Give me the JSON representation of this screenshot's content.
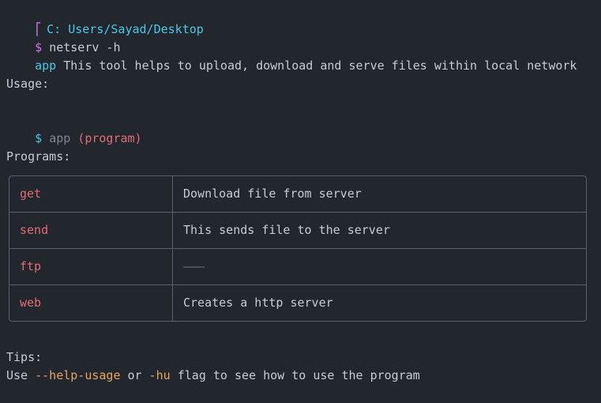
{
  "prompt": {
    "path": "C: Users/Sayad/Desktop",
    "dollar": "$",
    "command": "netserv -h"
  },
  "header": {
    "app_name": "app",
    "description": "This tool helps to upload, download and serve files within local network"
  },
  "usage": {
    "label": "Usage:",
    "dollar": "$",
    "app": "app",
    "arg": "(program)"
  },
  "programs": {
    "label": "Programs:",
    "rows": [
      {
        "name": "get",
        "desc": "Download file from server"
      },
      {
        "name": "send",
        "desc": "This sends file to the server"
      },
      {
        "name": "ftp",
        "desc": "———"
      },
      {
        "name": "web",
        "desc": "Creates a http server"
      }
    ]
  },
  "tips": {
    "label": "Tips:",
    "prefix": "Use ",
    "flag_long": "--help-usage",
    "middle": " or ",
    "flag_short": "-hu",
    "suffix": " flag to see how to use the program"
  },
  "colors": {
    "background": "#22272e",
    "text": "#c6ccd4",
    "cyan": "#4cc6e6",
    "red": "#e06c75",
    "orange": "#e5a55f",
    "purple": "#c678dd"
  }
}
